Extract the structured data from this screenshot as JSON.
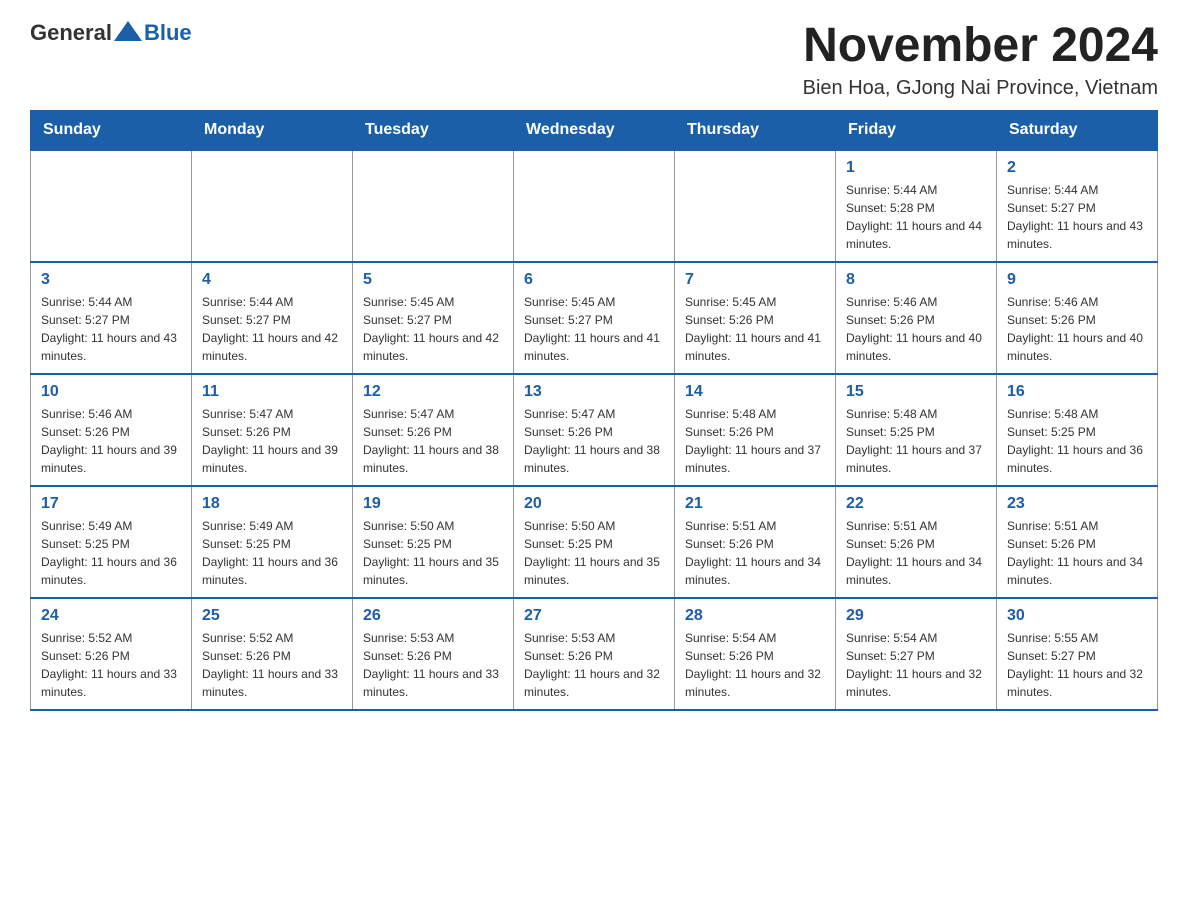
{
  "logo": {
    "text_general": "General",
    "text_blue": "Blue"
  },
  "title": "November 2024",
  "subtitle": "Bien Hoa, GJong Nai Province, Vietnam",
  "weekdays": [
    "Sunday",
    "Monday",
    "Tuesday",
    "Wednesday",
    "Thursday",
    "Friday",
    "Saturday"
  ],
  "weeks": [
    [
      {
        "day": "",
        "sunrise": "",
        "sunset": "",
        "daylight": ""
      },
      {
        "day": "",
        "sunrise": "",
        "sunset": "",
        "daylight": ""
      },
      {
        "day": "",
        "sunrise": "",
        "sunset": "",
        "daylight": ""
      },
      {
        "day": "",
        "sunrise": "",
        "sunset": "",
        "daylight": ""
      },
      {
        "day": "",
        "sunrise": "",
        "sunset": "",
        "daylight": ""
      },
      {
        "day": "1",
        "sunrise": "Sunrise: 5:44 AM",
        "sunset": "Sunset: 5:28 PM",
        "daylight": "Daylight: 11 hours and 44 minutes."
      },
      {
        "day": "2",
        "sunrise": "Sunrise: 5:44 AM",
        "sunset": "Sunset: 5:27 PM",
        "daylight": "Daylight: 11 hours and 43 minutes."
      }
    ],
    [
      {
        "day": "3",
        "sunrise": "Sunrise: 5:44 AM",
        "sunset": "Sunset: 5:27 PM",
        "daylight": "Daylight: 11 hours and 43 minutes."
      },
      {
        "day": "4",
        "sunrise": "Sunrise: 5:44 AM",
        "sunset": "Sunset: 5:27 PM",
        "daylight": "Daylight: 11 hours and 42 minutes."
      },
      {
        "day": "5",
        "sunrise": "Sunrise: 5:45 AM",
        "sunset": "Sunset: 5:27 PM",
        "daylight": "Daylight: 11 hours and 42 minutes."
      },
      {
        "day": "6",
        "sunrise": "Sunrise: 5:45 AM",
        "sunset": "Sunset: 5:27 PM",
        "daylight": "Daylight: 11 hours and 41 minutes."
      },
      {
        "day": "7",
        "sunrise": "Sunrise: 5:45 AM",
        "sunset": "Sunset: 5:26 PM",
        "daylight": "Daylight: 11 hours and 41 minutes."
      },
      {
        "day": "8",
        "sunrise": "Sunrise: 5:46 AM",
        "sunset": "Sunset: 5:26 PM",
        "daylight": "Daylight: 11 hours and 40 minutes."
      },
      {
        "day": "9",
        "sunrise": "Sunrise: 5:46 AM",
        "sunset": "Sunset: 5:26 PM",
        "daylight": "Daylight: 11 hours and 40 minutes."
      }
    ],
    [
      {
        "day": "10",
        "sunrise": "Sunrise: 5:46 AM",
        "sunset": "Sunset: 5:26 PM",
        "daylight": "Daylight: 11 hours and 39 minutes."
      },
      {
        "day": "11",
        "sunrise": "Sunrise: 5:47 AM",
        "sunset": "Sunset: 5:26 PM",
        "daylight": "Daylight: 11 hours and 39 minutes."
      },
      {
        "day": "12",
        "sunrise": "Sunrise: 5:47 AM",
        "sunset": "Sunset: 5:26 PM",
        "daylight": "Daylight: 11 hours and 38 minutes."
      },
      {
        "day": "13",
        "sunrise": "Sunrise: 5:47 AM",
        "sunset": "Sunset: 5:26 PM",
        "daylight": "Daylight: 11 hours and 38 minutes."
      },
      {
        "day": "14",
        "sunrise": "Sunrise: 5:48 AM",
        "sunset": "Sunset: 5:26 PM",
        "daylight": "Daylight: 11 hours and 37 minutes."
      },
      {
        "day": "15",
        "sunrise": "Sunrise: 5:48 AM",
        "sunset": "Sunset: 5:25 PM",
        "daylight": "Daylight: 11 hours and 37 minutes."
      },
      {
        "day": "16",
        "sunrise": "Sunrise: 5:48 AM",
        "sunset": "Sunset: 5:25 PM",
        "daylight": "Daylight: 11 hours and 36 minutes."
      }
    ],
    [
      {
        "day": "17",
        "sunrise": "Sunrise: 5:49 AM",
        "sunset": "Sunset: 5:25 PM",
        "daylight": "Daylight: 11 hours and 36 minutes."
      },
      {
        "day": "18",
        "sunrise": "Sunrise: 5:49 AM",
        "sunset": "Sunset: 5:25 PM",
        "daylight": "Daylight: 11 hours and 36 minutes."
      },
      {
        "day": "19",
        "sunrise": "Sunrise: 5:50 AM",
        "sunset": "Sunset: 5:25 PM",
        "daylight": "Daylight: 11 hours and 35 minutes."
      },
      {
        "day": "20",
        "sunrise": "Sunrise: 5:50 AM",
        "sunset": "Sunset: 5:25 PM",
        "daylight": "Daylight: 11 hours and 35 minutes."
      },
      {
        "day": "21",
        "sunrise": "Sunrise: 5:51 AM",
        "sunset": "Sunset: 5:26 PM",
        "daylight": "Daylight: 11 hours and 34 minutes."
      },
      {
        "day": "22",
        "sunrise": "Sunrise: 5:51 AM",
        "sunset": "Sunset: 5:26 PM",
        "daylight": "Daylight: 11 hours and 34 minutes."
      },
      {
        "day": "23",
        "sunrise": "Sunrise: 5:51 AM",
        "sunset": "Sunset: 5:26 PM",
        "daylight": "Daylight: 11 hours and 34 minutes."
      }
    ],
    [
      {
        "day": "24",
        "sunrise": "Sunrise: 5:52 AM",
        "sunset": "Sunset: 5:26 PM",
        "daylight": "Daylight: 11 hours and 33 minutes."
      },
      {
        "day": "25",
        "sunrise": "Sunrise: 5:52 AM",
        "sunset": "Sunset: 5:26 PM",
        "daylight": "Daylight: 11 hours and 33 minutes."
      },
      {
        "day": "26",
        "sunrise": "Sunrise: 5:53 AM",
        "sunset": "Sunset: 5:26 PM",
        "daylight": "Daylight: 11 hours and 33 minutes."
      },
      {
        "day": "27",
        "sunrise": "Sunrise: 5:53 AM",
        "sunset": "Sunset: 5:26 PM",
        "daylight": "Daylight: 11 hours and 32 minutes."
      },
      {
        "day": "28",
        "sunrise": "Sunrise: 5:54 AM",
        "sunset": "Sunset: 5:26 PM",
        "daylight": "Daylight: 11 hours and 32 minutes."
      },
      {
        "day": "29",
        "sunrise": "Sunrise: 5:54 AM",
        "sunset": "Sunset: 5:27 PM",
        "daylight": "Daylight: 11 hours and 32 minutes."
      },
      {
        "day": "30",
        "sunrise": "Sunrise: 5:55 AM",
        "sunset": "Sunset: 5:27 PM",
        "daylight": "Daylight: 11 hours and 32 minutes."
      }
    ]
  ]
}
